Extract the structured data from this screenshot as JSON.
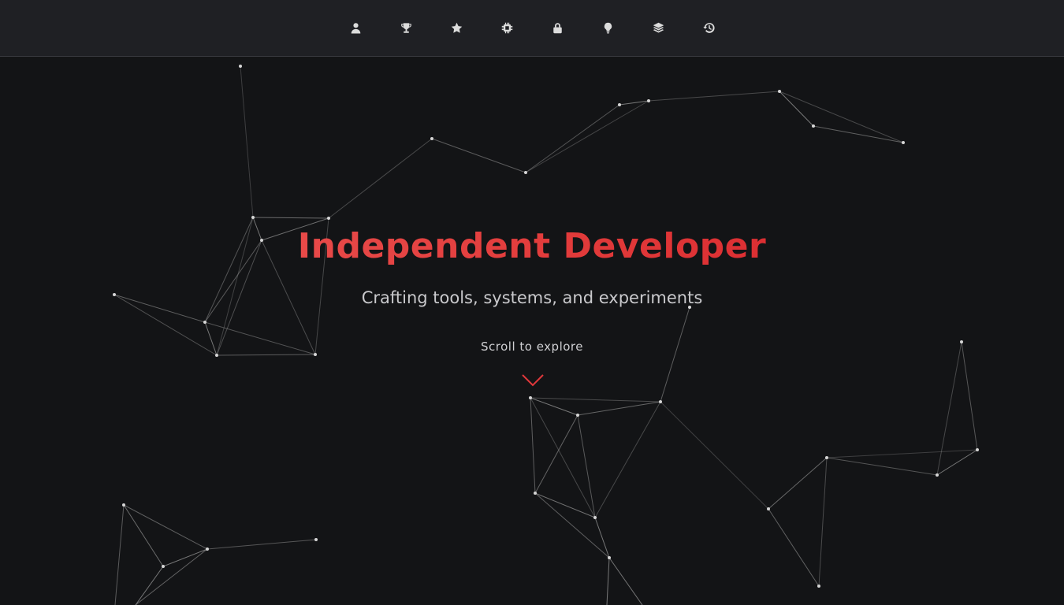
{
  "nav": {
    "items": [
      {
        "name": "nav-about",
        "icon": "user-icon"
      },
      {
        "name": "nav-achievements",
        "icon": "trophy-icon"
      },
      {
        "name": "nav-featured",
        "icon": "star-icon"
      },
      {
        "name": "nav-hardware",
        "icon": "chip-icon"
      },
      {
        "name": "nav-security",
        "icon": "lock-icon"
      },
      {
        "name": "nav-ideas",
        "icon": "lightbulb-icon"
      },
      {
        "name": "nav-stack",
        "icon": "layers-icon"
      },
      {
        "name": "nav-history",
        "icon": "history-icon"
      }
    ]
  },
  "hero": {
    "title": "Independent Developer",
    "subtitle": "Crafting tools, systems, and experiments",
    "scroll_hint": "Scroll to explore",
    "scroll_icon": "chevron-down-icon"
  },
  "colors": {
    "background": "#131416",
    "topbar": "#1f2024",
    "accent_start": "#ef5a58",
    "accent_end": "#d41c26",
    "node": "#d6d6d6",
    "edge": "#8a8a8a"
  }
}
